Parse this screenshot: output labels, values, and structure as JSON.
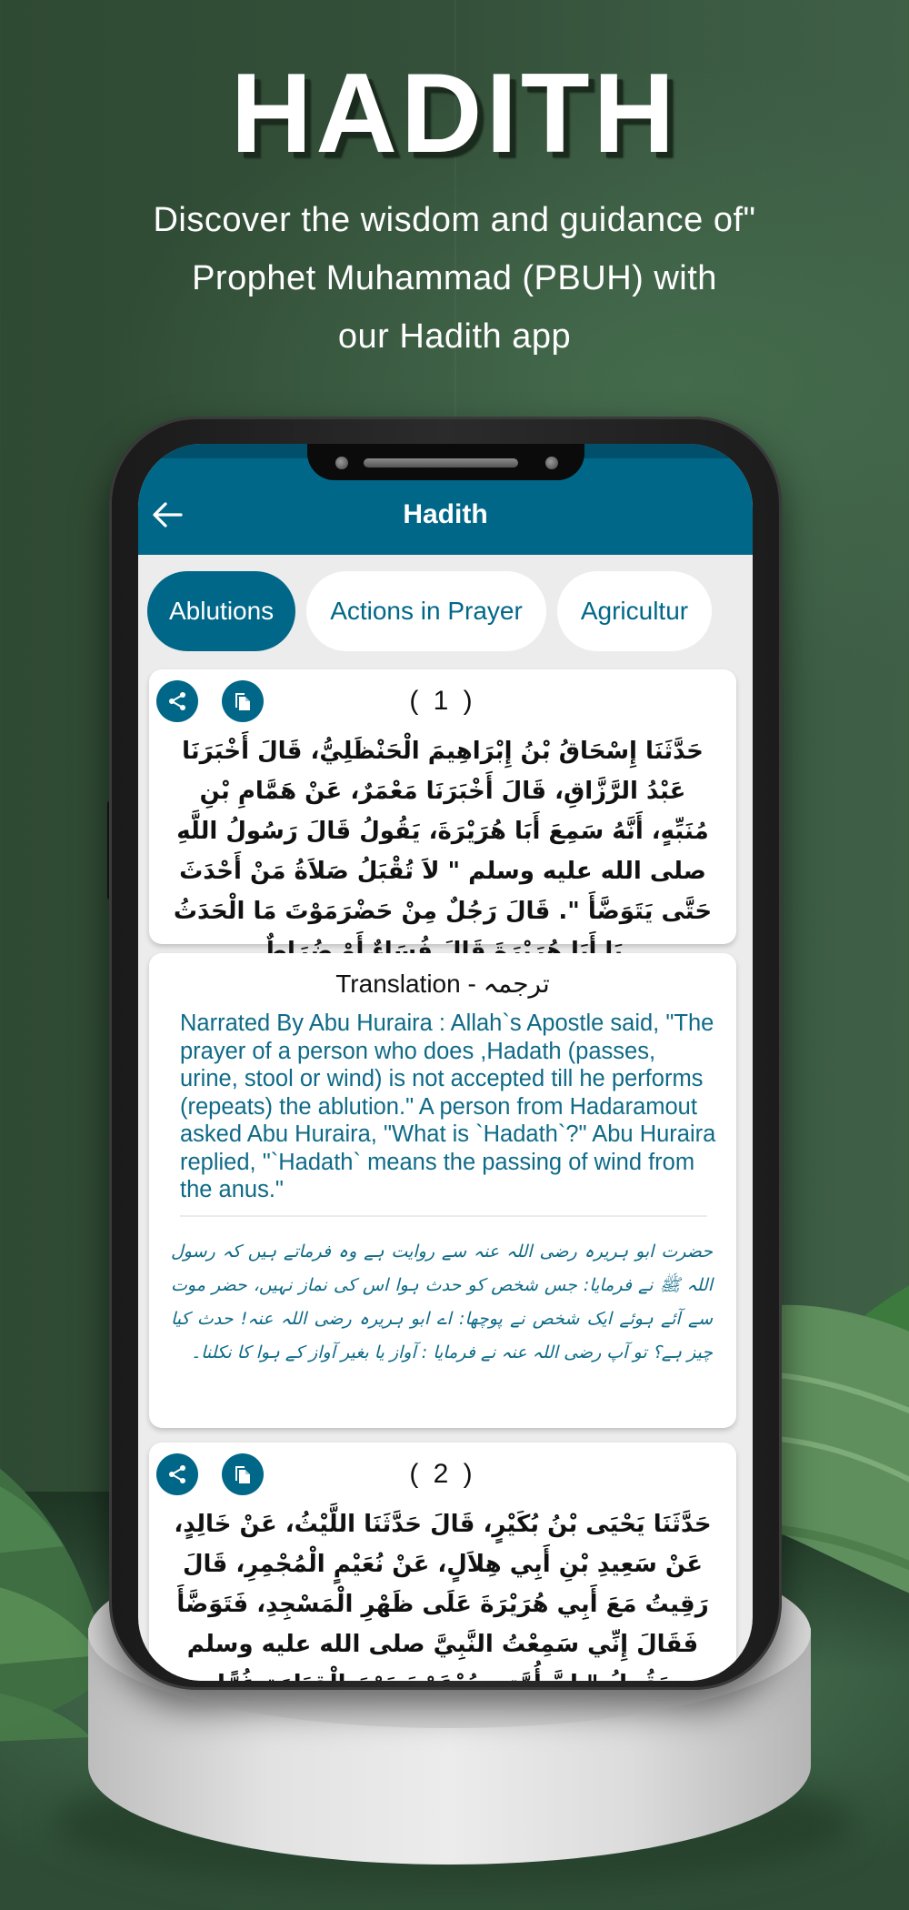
{
  "hero": {
    "title": "HADITH",
    "subtitle_lines": [
      "Discover the wisdom and guidance of\"",
      "Prophet Muhammad (PBUH) with",
      "our Hadith app"
    ]
  },
  "app": {
    "title": "Hadith",
    "back_icon": "arrow-left-icon",
    "colors": {
      "primary": "#016789",
      "screen_bg": "#ececec",
      "card_bg": "#ffffff",
      "translation_text": "#0e6a87"
    },
    "tabs": [
      {
        "label": "Ablutions",
        "active": true
      },
      {
        "label": "Actions in Prayer",
        "active": false
      },
      {
        "label": "Agricultur",
        "active": false
      }
    ],
    "hadiths": [
      {
        "number": "( 1 )",
        "share_icon": "share-icon",
        "copy_icon": "copy-icon",
        "arabic": "حَدَّثَنَا إِسْحَاقُ بْنُ إِبْرَاهِيمَ الْحَنْظَلِيُّ، قَالَ أَخْبَرَنَا عَبْدُ الرَّزَّاقِ، قَالَ أَخْبَرَنَا مَعْمَرٌ، عَنْ هَمَّامِ بْنِ مُنَبِّهٍ، أَنَّهُ سَمِعَ أَبَا هُرَيْرَةَ، يَقُولُ قَالَ رَسُولُ اللَّهِ صلى الله عليه وسلم \" لاَ تُقْبَلُ صَلاَةُ مَنْ أَحْدَثَ حَتَّى يَتَوَضَّأَ \". قَالَ رَجُلٌ مِنْ حَضْرَمَوْتَ مَا الْحَدَثُ يَا أَبَا هُرَيْرَةَ قَالَ فُسَاءٌ أَوْ ضُرَاطٌ"
      },
      {
        "number": "( 2 )",
        "share_icon": "share-icon",
        "copy_icon": "copy-icon",
        "arabic": "حَدَّثَنَا يَحْيَى بْنُ بُكَيْرٍ، قَالَ حَدَّثَنَا اللَّيْثُ، عَنْ خَالِدٍ، عَنْ سَعِيدِ بْنِ أَبِي هِلاَلٍ، عَنْ نُعَيْمٍ الْمُجْمِرِ، قَالَ رَقِيتُ مَعَ أَبِي هُرَيْرَةَ عَلَى ظَهْرِ الْمَسْجِدِ، فَتَوَضَّأَ فَقَالَ إِنِّي سَمِعْتُ النَّبِيَّ صلى الله عليه وسلم يَقُولُ \" إِنَّ أُمَّتِي يُدْعَوْنَ يَوْمَ الْقِيَامَةِ غُرًّا مُحَجَّلِينَ مِنْ آثَارِ الْوُضُوءِ، فَمَنِ"
      }
    ],
    "translation": {
      "heading": "Translation  -  ترجمہ",
      "english": "Narrated By Abu Huraira : Allah`s Apostle said, \"The prayer of a person who does ,Hadath (passes, urine, stool or wind) is not accepted till he performs (repeats) the ablution.\" A person from Hadaramout asked Abu Huraira, \"What is `Hadath`?\" Abu Huraira replied, \"`Hadath` means the passing of wind from the anus.\"",
      "urdu": "حضرت ابو ہریرہ رضی اللہ عنہ سے روایت ہے وہ فرماتے ہیں کہ رسول اللہ ﷺ نے فرمایا: جس شخص کو حدث ہوا اس کی نماز نہیں، حضر موت سے آئے ہوئے ایک شخص نے پوچھا: اے ابو ہریرہ رضی اللہ عنہ! حدث کیا چیز ہے؟ تو آپ رضی اللہ عنہ نے فرمایا : آواز یا بغیر آواز کے ہوا کا نکلنا۔"
    }
  }
}
